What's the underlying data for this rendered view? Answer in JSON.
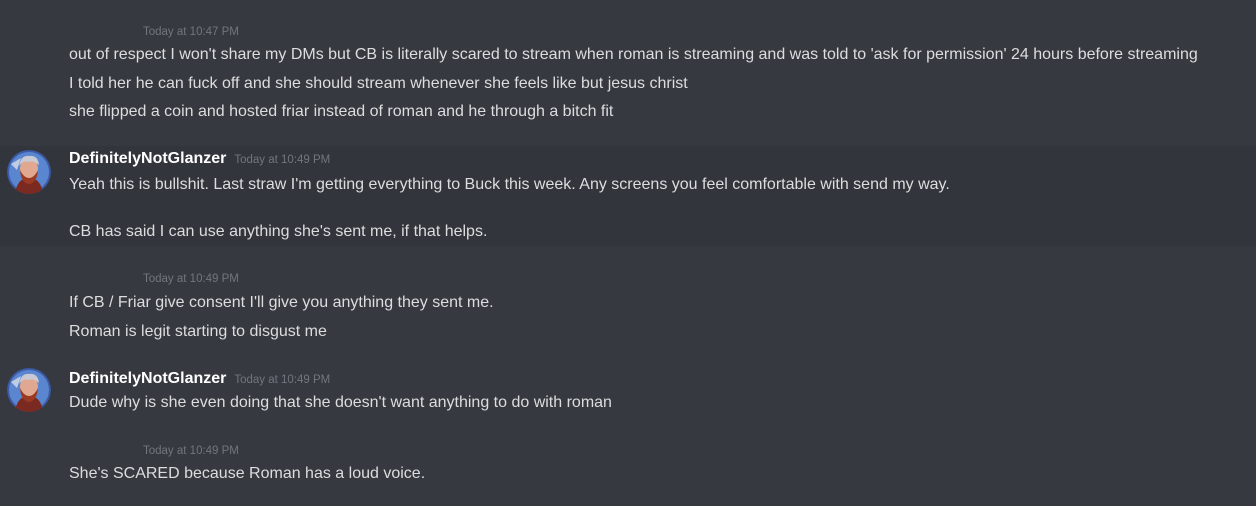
{
  "groups": [
    {
      "timestamp": "Today at 10:47 PM",
      "lines": [
        "out of respect I won't share my DMs but CB is literally scared to stream when roman is streaming and was told to 'ask for permission' 24 hours before streaming",
        "I told her he can fuck off and she should stream whenever she feels like but jesus christ",
        "she flipped a coin and hosted friar instead of roman and he through a bitch fit"
      ]
    },
    {
      "author": "DefinitelyNotGlanzer",
      "timestamp": "Today at 10:49 PM",
      "lines": [
        "Yeah this is bullshit. Last straw I'm getting everything to Buck this week. Any screens you feel comfortable with send my way.",
        "CB has said I can use anything she's sent me, if that helps."
      ]
    },
    {
      "timestamp": "Today at 10:49 PM",
      "lines": [
        "If CB / Friar give consent I'll give you anything they sent me.",
        "Roman is legit starting to disgust me"
      ]
    },
    {
      "author": "DefinitelyNotGlanzer",
      "timestamp": "Today at 10:49 PM",
      "lines": [
        "Dude why is she even doing that she doesn't want anything to do with roman"
      ]
    },
    {
      "timestamp": "Today at 10:49 PM",
      "lines": [
        "She's SCARED because Roman has a loud voice."
      ]
    }
  ],
  "colors": {
    "background": "#36393f",
    "hover": "#32353b",
    "text": "#dcddde",
    "muted": "#72767d"
  },
  "icons": {
    "avatar": "user-avatar-icon"
  }
}
